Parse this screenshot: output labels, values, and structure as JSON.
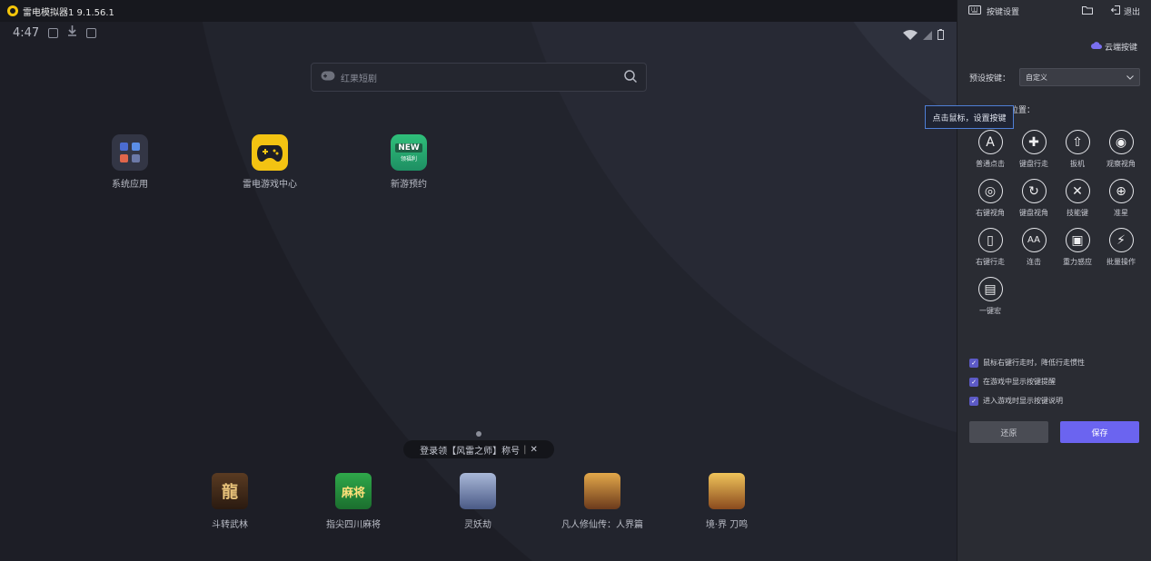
{
  "window": {
    "title": "雷电模拟器1 9.1.56.1"
  },
  "status": {
    "time": "4:47"
  },
  "search": {
    "placeholder": "红果短剧"
  },
  "desktop_apps": [
    {
      "label": "系统应用"
    },
    {
      "label": "雷电游戏中心"
    },
    {
      "label": "新游预约",
      "badge": "NEW",
      "sub": "领福利"
    }
  ],
  "promo": {
    "text": "登录领【风雷之师】称号",
    "close": "✕"
  },
  "games": [
    {
      "label": "斗转武林",
      "glyph": "龍"
    },
    {
      "label": "指尖四川麻将",
      "glyph": "麻将"
    },
    {
      "label": "灵妖劫",
      "glyph": ""
    },
    {
      "label": "凡人修仙传：人界篇",
      "glyph": ""
    },
    {
      "label": "境·界 刀鸣",
      "glyph": ""
    }
  ],
  "panel": {
    "title": "按键设置",
    "exit": "退出",
    "cloud": "云端按键",
    "preset_label": "预设按键：",
    "preset_value": "自定义",
    "drag_tip": "拖动到游戏位置：",
    "tooltip": "点击鼠标，设置按键",
    "keys": [
      {
        "label": "普通点击",
        "glyph": "A"
      },
      {
        "label": "键盘行走",
        "glyph": "✚"
      },
      {
        "label": "扳机",
        "glyph": "⇧"
      },
      {
        "label": "观察视角",
        "glyph": "◉"
      },
      {
        "label": "右键视角",
        "glyph": "◎"
      },
      {
        "label": "键盘视角",
        "glyph": "↻"
      },
      {
        "label": "技能键",
        "glyph": "✕"
      },
      {
        "label": "准星",
        "glyph": "⊕"
      },
      {
        "label": "右键行走",
        "glyph": "▯"
      },
      {
        "label": "连击",
        "glyph": "AA"
      },
      {
        "label": "重力感应",
        "glyph": "▣"
      },
      {
        "label": "批量操作",
        "glyph": "⚡"
      },
      {
        "label": "一键宏",
        "glyph": "▤"
      }
    ],
    "options": [
      {
        "label": "鼠标右键行走时，降低行走惯性",
        "checked": true
      },
      {
        "label": "在游戏中显示按键提醒",
        "checked": true
      },
      {
        "label": "进入游戏时显示按键说明",
        "checked": true
      }
    ],
    "reset": "还原",
    "save": "保存"
  },
  "colors": {
    "accent": "#6b64f0",
    "panel": "#2a2c33",
    "logo": "#f5c60a"
  }
}
